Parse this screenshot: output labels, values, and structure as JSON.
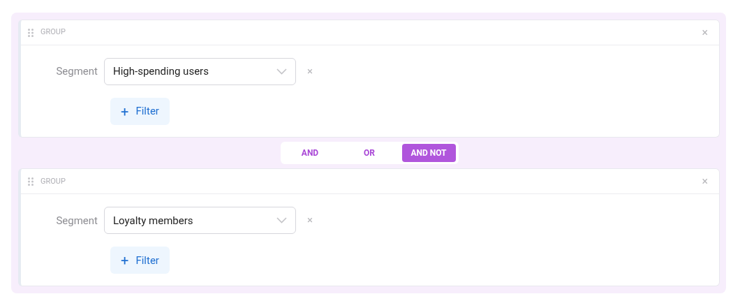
{
  "groups": [
    {
      "title": "GROUP",
      "segment_label": "Segment",
      "segment_value": "High-spending users",
      "add_filter": "Filter",
      "add_icon": "+",
      "remove_icon": "×",
      "close_icon": "×"
    },
    {
      "title": "GROUP",
      "segment_label": "Segment",
      "segment_value": "Loyalty members",
      "add_filter": "Filter",
      "add_icon": "+",
      "remove_icon": "×",
      "close_icon": "×"
    }
  ],
  "operators": [
    {
      "label": "AND",
      "selected": false
    },
    {
      "label": "OR",
      "selected": false
    },
    {
      "label": "AND NOT",
      "selected": true
    }
  ]
}
